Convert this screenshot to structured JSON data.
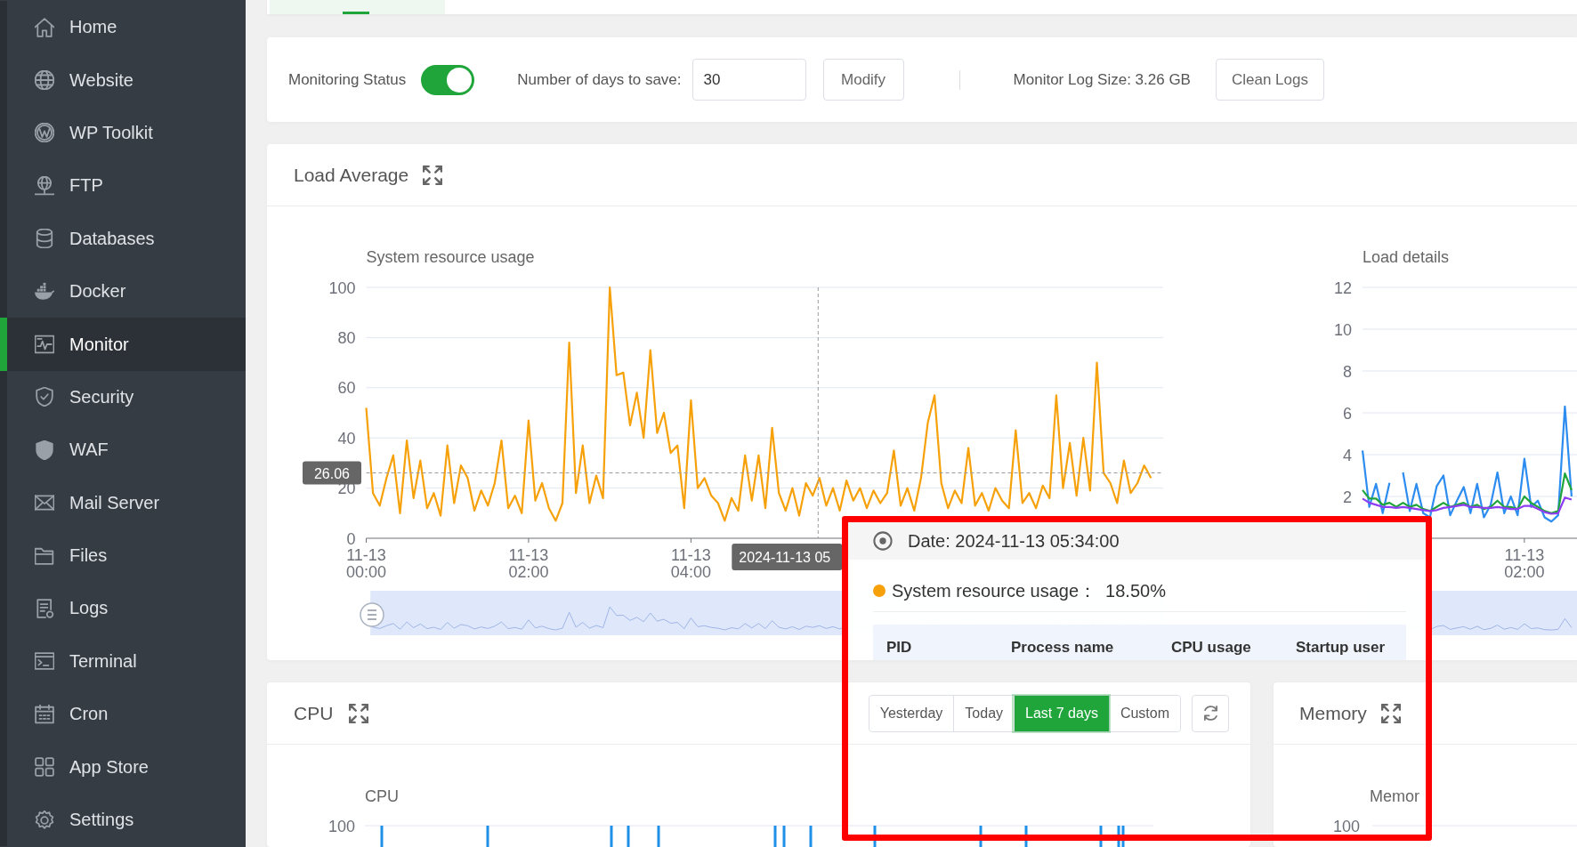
{
  "sidebar": {
    "items": [
      {
        "label": "Home",
        "selected": false
      },
      {
        "label": "Website",
        "selected": false
      },
      {
        "label": "WP Toolkit",
        "selected": false
      },
      {
        "label": "FTP",
        "selected": false
      },
      {
        "label": "Databases",
        "selected": false
      },
      {
        "label": "Docker",
        "selected": false
      },
      {
        "label": "Monitor",
        "selected": true
      },
      {
        "label": "Security",
        "selected": false
      },
      {
        "label": "WAF",
        "selected": false
      },
      {
        "label": "Mail Server",
        "selected": false
      },
      {
        "label": "Files",
        "selected": false
      },
      {
        "label": "Logs",
        "selected": false
      },
      {
        "label": "Terminal",
        "selected": false
      },
      {
        "label": "Cron",
        "selected": false
      },
      {
        "label": "App Store",
        "selected": false
      },
      {
        "label": "Settings",
        "selected": false
      }
    ]
  },
  "page_tabs": [
    {
      "selected": true
    }
  ],
  "settings_bar": {
    "monitoring_label": "Monitoring Status",
    "monitoring_on": true,
    "days_label": "Number of days to save:",
    "days_value": "30",
    "modify_button": "Modify",
    "log_size": "Monitor Log Size: 3.26 GB",
    "clean_button": "Clean Logs"
  },
  "load_average": {
    "title": "Load Average",
    "charts": [
      {
        "chart_data": {
          "type": "line",
          "title": "System resource usage",
          "grid": true,
          "categories": [
            "11-13 00:00",
            null,
            null,
            null,
            null,
            null,
            null,
            null,
            null,
            null,
            null,
            null,
            null,
            null,
            null,
            null,
            null,
            null,
            null,
            null,
            null,
            null,
            null,
            null,
            "11-13 02:00",
            null,
            null,
            null,
            null,
            null,
            null,
            null,
            null,
            null,
            null,
            null,
            null,
            null,
            null,
            null,
            null,
            null,
            null,
            null,
            null,
            null,
            null,
            null,
            "11-13 04:00",
            null,
            null,
            null,
            null,
            null,
            null,
            null,
            null,
            null,
            null,
            null,
            null,
            null,
            null,
            null,
            null,
            null,
            null,
            null,
            null,
            null,
            null,
            null,
            null,
            null,
            null,
            null,
            null,
            null,
            null,
            null,
            null,
            null,
            null,
            null,
            null,
            null,
            null,
            null,
            null,
            null,
            null,
            null,
            null,
            null,
            null,
            null,
            null,
            null,
            null,
            null,
            null,
            null,
            null,
            null,
            null,
            null,
            null,
            null,
            null,
            null,
            null,
            null,
            null,
            null,
            null,
            null,
            null
          ],
          "ylim": [
            0,
            100
          ],
          "yticks": [
            0,
            20,
            40,
            60,
            80,
            100
          ],
          "series": [
            {
              "color": "#f7a10a",
              "values": [
                52,
                18,
                13,
                24,
                33,
                10,
                39,
                16,
                31,
                12,
                18,
                9,
                37,
                14,
                29,
                24,
                11,
                19,
                13,
                22,
                39,
                12,
                17,
                10,
                47,
                15,
                22,
                12,
                7,
                14,
                78,
                18,
                37,
                14,
                25,
                16,
                100,
                65,
                66,
                45,
                58,
                40,
                75,
                42,
                50,
                34,
                37,
                12,
                55,
                20,
                24,
                17,
                14,
                7,
                16,
                11,
                33,
                15,
                33,
                12,
                44,
                18,
                11,
                20,
                9,
                22,
                17,
                24,
                13,
                20,
                11,
                23,
                15,
                20,
                12,
                19,
                14,
                18,
                35,
                13,
                20,
                11,
                24,
                46,
                57,
                22,
                12,
                19,
                14,
                36,
                13,
                18,
                11,
                20,
                15,
                12,
                43,
                14,
                18,
                12,
                21,
                16,
                57,
                20,
                38,
                17,
                40,
                19,
                70,
                26,
                22,
                14,
                31,
                18,
                22,
                29,
                24
              ]
            }
          ],
          "ref_lines": [
            {
              "axis": "y",
              "value": 26.06,
              "label": "26.06"
            }
          ]
        },
        "pointer": {
          "x_label": "2024-11-13 05"
        },
        "zoom": {
          "level": 1,
          "handle": true
        }
      },
      {
        "chart_data": {
          "type": "line",
          "title": "Load details",
          "grid": true,
          "categories": [
            null,
            null,
            null,
            null,
            null,
            null,
            null,
            null,
            null,
            null,
            null,
            null,
            null,
            null,
            null,
            null,
            null,
            null,
            null,
            null,
            null,
            null,
            null,
            null,
            "11-13 02:00",
            null,
            null,
            null,
            null,
            null,
            null,
            null
          ],
          "ylim": [
            0,
            12
          ],
          "yticks": [
            2,
            4,
            6,
            8,
            10,
            12
          ],
          "series": [
            {
              "color": "#2d8cf0",
              "values": [
                4.2,
                1.5,
                2.6,
                1.2,
                2.65,
                null,
                3.15,
                1.3,
                2.6,
                1.2,
                1.0,
                2.5,
                3.0,
                1.1,
                1.8,
                2.45,
                1.2,
                2.6,
                1.0,
                1.6,
                3.15,
                1.2,
                2.0,
                1.1,
                3.8,
                1.5,
                1.8,
                1.0,
                0.8,
                1.1,
                6.3,
                2.0
              ]
            },
            {
              "color": "#20a53a",
              "values": [
                2.3,
                1.9,
                1.9,
                1.6,
                1.7,
                1.5,
                1.7,
                1.5,
                1.6,
                1.4,
                1.3,
                1.5,
                1.7,
                1.5,
                1.6,
                1.7,
                1.5,
                1.6,
                1.4,
                1.5,
                1.8,
                1.5,
                1.5,
                1.4,
                2.0,
                1.7,
                1.5,
                1.3,
                1.2,
                1.3,
                3.1,
                2.3
              ]
            },
            {
              "color": "#8e3ef0",
              "values": [
                1.9,
                1.7,
                1.6,
                1.5,
                1.5,
                1.45,
                1.5,
                1.45,
                1.4,
                1.35,
                1.3,
                1.35,
                1.45,
                1.5,
                1.55,
                1.6,
                1.5,
                1.5,
                1.45,
                1.45,
                1.5,
                1.45,
                1.4,
                1.4,
                1.55,
                1.55,
                1.4,
                1.25,
                1.17,
                1.2,
                1.95,
                1.85
              ]
            }
          ]
        },
        "zoom": {
          "level": 1,
          "handle": false
        }
      }
    ],
    "tooltip": {
      "date": "Date: 2024-11-13 05:34:00",
      "items": [
        {
          "label": "System resource usage：",
          "value": "18.50%",
          "color": "#f7a10a"
        }
      ],
      "columns": [
        "PID",
        "Process name",
        "CPU usage",
        "Startup user"
      ]
    }
  },
  "cpu": {
    "title": "CPU",
    "ranges": [
      {
        "label": "Yesterday",
        "selected": false
      },
      {
        "label": "Today",
        "selected": false
      },
      {
        "label": "Last 7 days",
        "selected": true
      },
      {
        "label": "Custom",
        "selected": false
      }
    ],
    "chart_label": "CPU",
    "y_tick": "100"
  },
  "memory": {
    "title": "Memory",
    "chart_label": "Memor",
    "y_tick": "100"
  }
}
